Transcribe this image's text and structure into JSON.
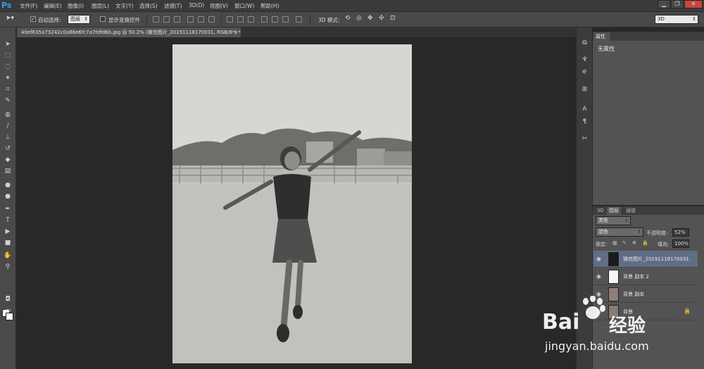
{
  "app": {
    "logo": "Ps"
  },
  "menu": [
    "文件(F)",
    "编辑(E)",
    "图像(I)",
    "图层(L)",
    "文字(Y)",
    "选择(S)",
    "滤镜(T)",
    "3D(D)",
    "视图(V)",
    "窗口(W)",
    "帮助(H)"
  ],
  "window_controls": [
    "▁",
    "❐",
    "✕"
  ],
  "options_bar": {
    "auto_select_label": "自动选择:",
    "auto_select_value": "图层",
    "show_transform_label": "显示变换控件",
    "mode_3d_label": "3D 模式:",
    "workspace_value": "3D"
  },
  "document_tab": {
    "title": "40ef635a73242c0a86e6fc7a7fdfd6b.jpg @ 50.2% (微信图片_20191118170031, RGB/8*) *",
    "close": "×"
  },
  "properties_panel": {
    "tab": "属性",
    "content": "无属性"
  },
  "layers_panel": {
    "tabs": [
      "3D",
      "图层",
      "通道"
    ],
    "filter_value": "类型",
    "blend_mode": "滤色",
    "opacity_label": "不透明度:",
    "opacity_value": "52%",
    "lock_label": "锁定:",
    "fill_label": "填充:",
    "fill_value": "100%",
    "layers": [
      {
        "name": "微信图片_20191118170031",
        "selected": true
      },
      {
        "name": "背景 副本 2",
        "selected": false
      },
      {
        "name": "背景 副本",
        "selected": false
      },
      {
        "name": "背景",
        "selected": false
      }
    ]
  },
  "watermark": {
    "brand": "Bai",
    "brand2": "经验",
    "url": "jingyan.baidu.com"
  }
}
